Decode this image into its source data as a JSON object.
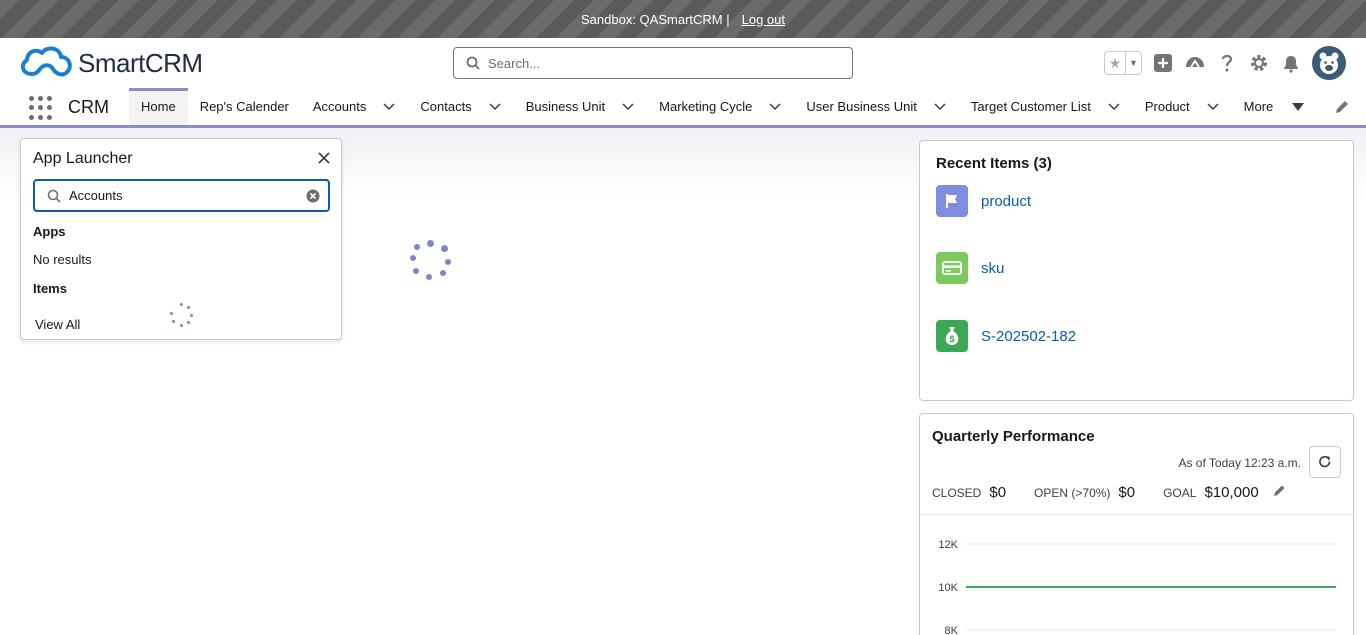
{
  "sandbox": {
    "text": "Sandbox: QASmartCRM |",
    "logout": "Log out"
  },
  "header": {
    "logo_text": "SmartCRM",
    "search_placeholder": "Search..."
  },
  "nav": {
    "app_name": "CRM",
    "items": [
      {
        "label": "Home",
        "active": true,
        "dropdown": false
      },
      {
        "label": "Rep's Calender",
        "dropdown": false
      },
      {
        "label": "Accounts",
        "dropdown": true
      },
      {
        "label": "Contacts",
        "dropdown": true
      },
      {
        "label": "Business Unit",
        "dropdown": true
      },
      {
        "label": "Marketing Cycle",
        "dropdown": true
      },
      {
        "label": "User Business Unit",
        "dropdown": true
      },
      {
        "label": "Target Customer List",
        "dropdown": true
      },
      {
        "label": "Product",
        "dropdown": true
      },
      {
        "label": "More",
        "dropdown": true
      }
    ]
  },
  "launcher": {
    "title": "App Launcher",
    "search_value": "Accounts",
    "apps_heading": "Apps",
    "apps_empty": "No results",
    "items_heading": "Items",
    "view_all": "View All"
  },
  "recent": {
    "title": "Recent Items (3)",
    "items": [
      {
        "label": "product",
        "icon": "flag-icon",
        "color": "#7f8de1"
      },
      {
        "label": "sku",
        "icon": "card-icon",
        "color": "#7ecb5d"
      },
      {
        "label": "S-202502-182",
        "icon": "money-bag-icon",
        "color": "#3ba755"
      }
    ]
  },
  "quarterly": {
    "title": "Quarterly Performance",
    "as_of": "As of Today 12:23 a.m.",
    "closed_label": "CLOSED",
    "closed_value": "$0",
    "open_label": "OPEN (>70%)",
    "open_value": "$0",
    "goal_label": "GOAL",
    "goal_value": "$10,000"
  },
  "chart_data": {
    "type": "line",
    "y_ticks": [
      "12K",
      "10K",
      "8K"
    ],
    "y_tick_values": [
      12000,
      10000,
      8000
    ],
    "goal_line": 10000,
    "line_color": "#3ba755"
  }
}
